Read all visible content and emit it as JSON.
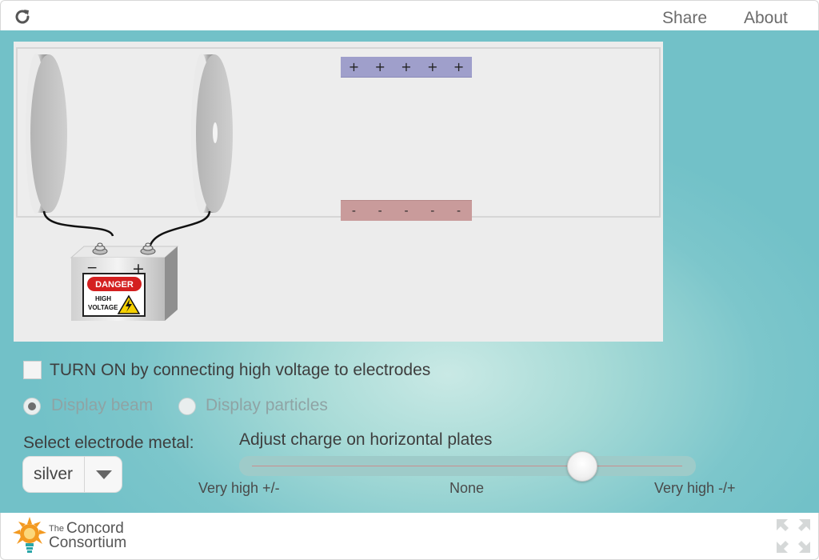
{
  "topbar": {
    "share_label": "Share",
    "about_label": "About"
  },
  "simulation": {
    "top_plate_signs": [
      "+",
      "+",
      "+",
      "+",
      "+"
    ],
    "bottom_plate_signs": [
      "-",
      "-",
      "-",
      "-",
      "-"
    ],
    "battery": {
      "neg_terminal": "−",
      "pos_terminal": "+",
      "danger_text": "DANGER",
      "high_text": "HIGH",
      "voltage_text": "VOLTAGE"
    }
  },
  "controls": {
    "turn_on_label": "TURN ON by connecting high voltage to electrodes",
    "turn_on_checked": false,
    "display_beam_label": "Display beam",
    "display_particles_label": "Display particles",
    "display_selected": "beam",
    "metal_label": "Select electrode metal:",
    "metal_value": "silver",
    "charge_label": "Adjust charge on horizontal plates",
    "slider_ticks": [
      "Very high +/-",
      "None",
      "Very high -/+"
    ],
    "slider_value_fraction": 0.77
  },
  "footer": {
    "logo_the": "The",
    "logo_concord": "Concord",
    "logo_consortium": "Consortium"
  },
  "colors": {
    "top_plate": "#9f9fcb",
    "bottom_plate": "#c99b9b",
    "background_teal": "#72c1c8",
    "logo_orange": "#f39a21"
  }
}
